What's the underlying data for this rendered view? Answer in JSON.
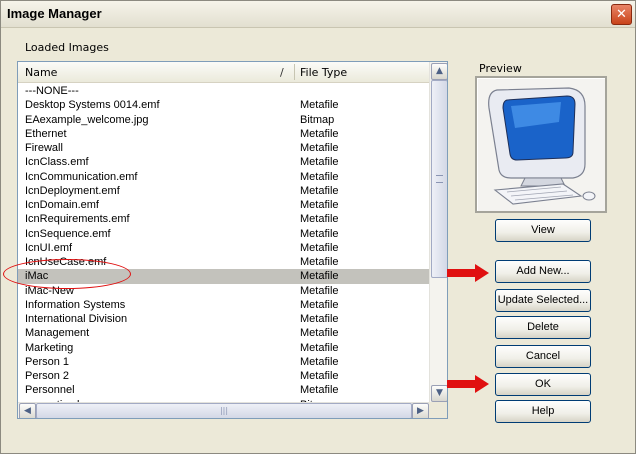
{
  "window": {
    "title": "Image Manager",
    "close_glyph": "✕"
  },
  "list_label": "Loaded Images",
  "columns": {
    "name": "Name",
    "sort_glyph": "/",
    "type": "File Type"
  },
  "rows": [
    {
      "name": "---NONE---",
      "type": ""
    },
    {
      "name": "Desktop Systems 0014.emf",
      "type": "Metafile"
    },
    {
      "name": "EAexample_welcome.jpg",
      "type": "Bitmap"
    },
    {
      "name": "Ethernet",
      "type": "Metafile"
    },
    {
      "name": "Firewall",
      "type": "Metafile"
    },
    {
      "name": "IcnClass.emf",
      "type": "Metafile"
    },
    {
      "name": "IcnCommunication.emf",
      "type": "Metafile"
    },
    {
      "name": "IcnDeployment.emf",
      "type": "Metafile"
    },
    {
      "name": "IcnDomain.emf",
      "type": "Metafile"
    },
    {
      "name": "IcnRequirements.emf",
      "type": "Metafile"
    },
    {
      "name": "IcnSequence.emf",
      "type": "Metafile"
    },
    {
      "name": "IcnUI.emf",
      "type": "Metafile"
    },
    {
      "name": "IcnUseCase.emf",
      "type": "Metafile"
    },
    {
      "name": "iMac",
      "type": "Metafile",
      "selected": true
    },
    {
      "name": "iMac-New",
      "type": "Metafile"
    },
    {
      "name": "Information Systems",
      "type": "Metafile"
    },
    {
      "name": "International Division",
      "type": "Metafile"
    },
    {
      "name": "Management",
      "type": "Metafile"
    },
    {
      "name": "Marketing",
      "type": "Metafile"
    },
    {
      "name": "Person 1",
      "type": "Metafile"
    },
    {
      "name": "Person 2",
      "type": "Metafile"
    },
    {
      "name": "Personnel",
      "type": "Metafile"
    },
    {
      "name": "properties.bmp",
      "type": "Bitmap"
    }
  ],
  "scroll": {
    "up": "▲",
    "down": "▼",
    "left": "◀",
    "right": "▶",
    "h_grip": "|||"
  },
  "preview": {
    "label": "Preview"
  },
  "buttons": {
    "view": "View",
    "add_new": "Add New...",
    "update_selected": "Update Selected...",
    "delete": "Delete",
    "cancel": "Cancel",
    "ok": "OK",
    "help": "Help"
  },
  "annotation_color": "#e01010"
}
